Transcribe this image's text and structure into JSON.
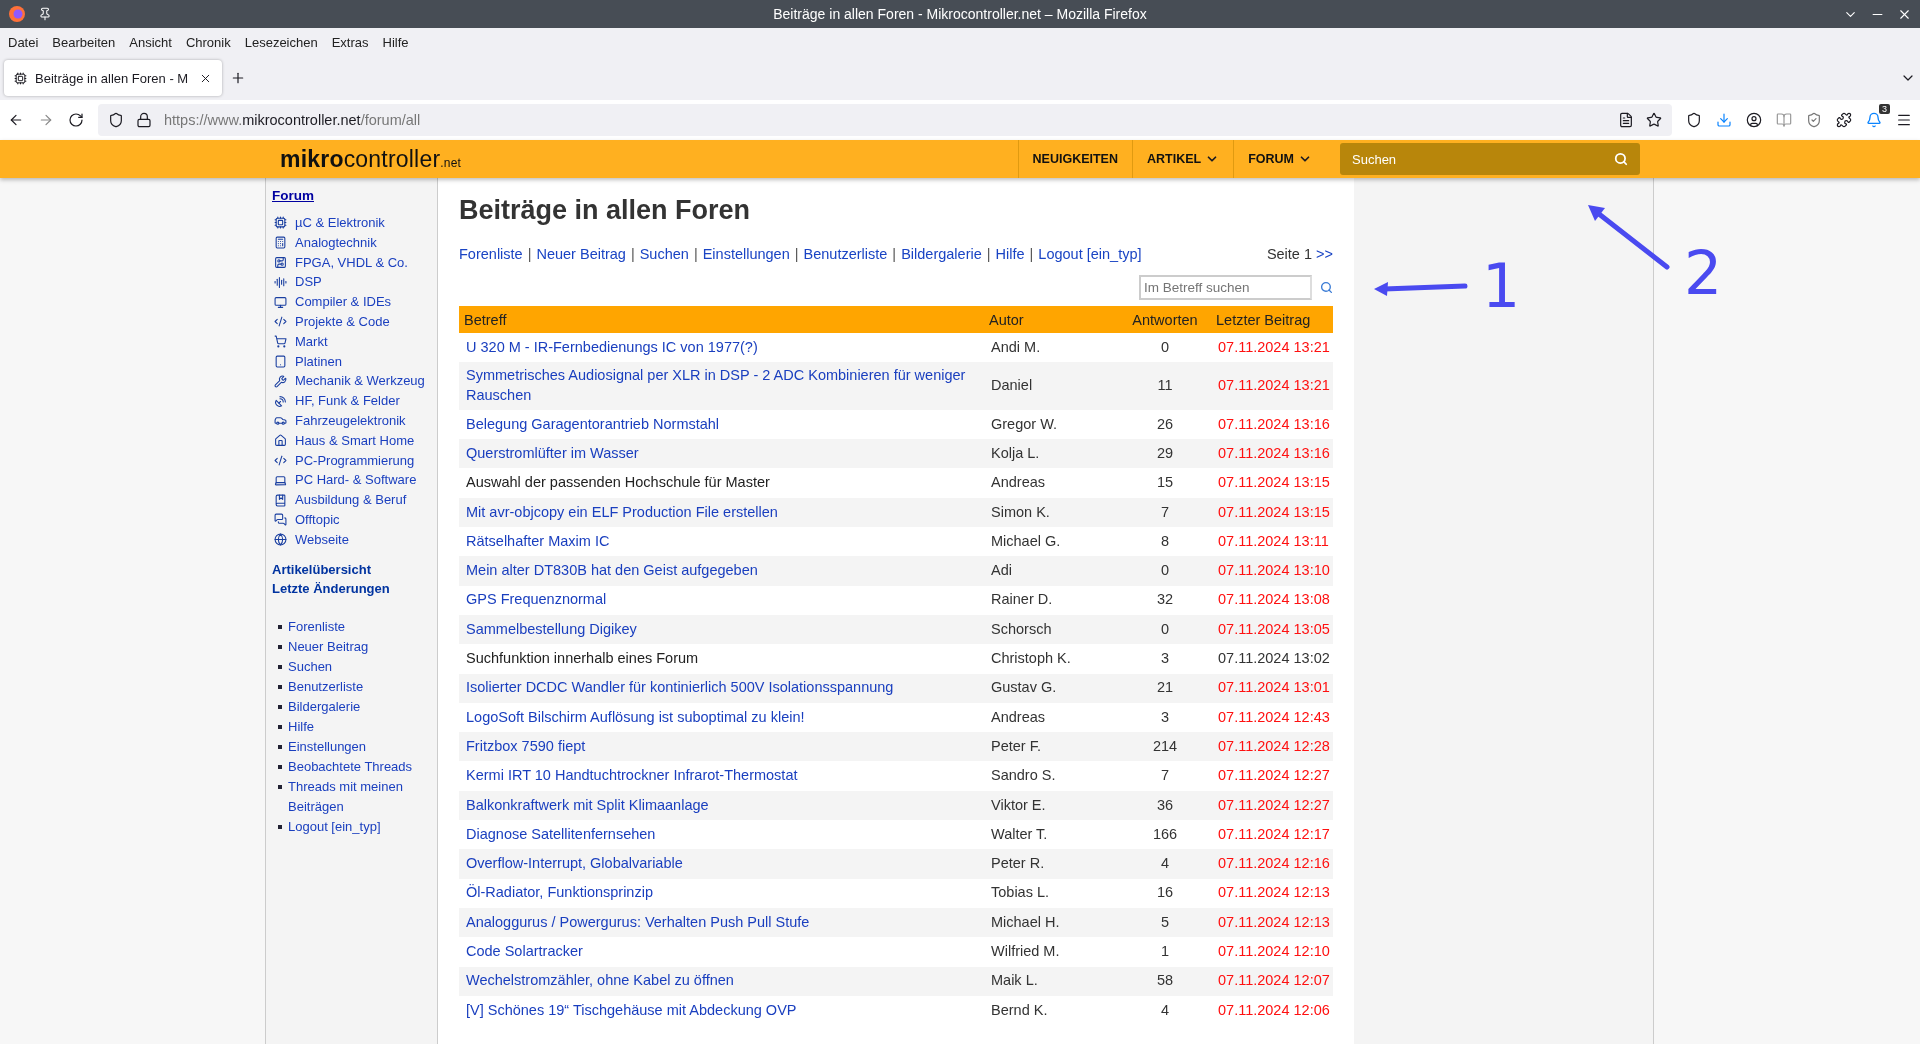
{
  "window": {
    "title": "Beiträge in allen Foren - Mikrocontroller.net – Mozilla Firefox"
  },
  "menu_bar": [
    "Datei",
    "Bearbeiten",
    "Ansicht",
    "Chronik",
    "Lesezeichen",
    "Extras",
    "Hilfe"
  ],
  "tabs": [
    {
      "label": "Beiträge in allen Foren - M",
      "selected": true
    }
  ],
  "address_bar": {
    "prefix": "https://www.",
    "domain": "mikrocontroller.net",
    "path": "/forum/all"
  },
  "toolbar": {
    "notification_badge": "3"
  },
  "site_header": {
    "logo_bold": "mikro",
    "logo_light": "controller",
    "logo_suffix": ".net",
    "nav": [
      {
        "label": "NEUIGKEITEN",
        "dropdown": false
      },
      {
        "label": "ARTIKEL",
        "dropdown": true
      },
      {
        "label": "FORUM",
        "dropdown": true
      }
    ],
    "search": {
      "placeholder": "Suchen"
    }
  },
  "sidebar": {
    "heading": "Forum",
    "forums": [
      "µC & Elektronik",
      "Analogtechnik",
      "FPGA, VHDL & Co.",
      "DSP",
      "Compiler & IDEs",
      "Projekte & Code",
      "Markt",
      "Platinen",
      "Mechanik & Werkzeug",
      "HF, Funk & Felder",
      "Fahrzeugelektronik",
      "Haus & Smart Home",
      "PC-Programmierung",
      "PC Hard- & Software",
      "Ausbildung & Beruf",
      "Offtopic",
      "Webseite"
    ],
    "bold_links": [
      "Artikelübersicht",
      "Letzte Änderungen"
    ],
    "links": [
      "Forenliste",
      "Neuer Beitrag",
      "Suchen",
      "Benutzerliste",
      "Bildergalerie",
      "Hilfe",
      "Einstellungen",
      "Beobachtete Threads",
      "Threads mit meinen Beiträgen",
      "Logout [ein_typ]"
    ]
  },
  "main": {
    "title": "Beiträge in allen Foren",
    "separator": "|",
    "links": [
      "Forenliste",
      "Neuer Beitrag",
      "Suchen",
      "Einstellungen",
      "Benutzerliste",
      "Bildergalerie",
      "Hilfe",
      "Logout [ein_typ]"
    ],
    "page_label": "Seite 1",
    "next_link": ">>",
    "subject_search": {
      "placeholder": "Im Betreff suchen"
    }
  },
  "table": {
    "columns": [
      "Betreff",
      "Autor",
      "Antworten",
      "Letzter Beitrag"
    ],
    "rows": [
      {
        "subject": "U 320 M - IR-Fernbedienungs IC von 1977(?)",
        "author": "Andi M.",
        "replies": "0",
        "last": "07.11.2024 13:21",
        "visited": false,
        "new": true
      },
      {
        "subject": "Symmetrisches Audiosignal per XLR in DSP - 2 ADC Kombinieren für weniger Rauschen",
        "author": "Daniel",
        "replies": "11",
        "last": "07.11.2024 13:21",
        "visited": false,
        "new": true
      },
      {
        "subject": "Belegung Garagentorantrieb Normstahl",
        "author": "Gregor W.",
        "replies": "26",
        "last": "07.11.2024 13:16",
        "visited": false,
        "new": true
      },
      {
        "subject": "Querstromlüfter im Wasser",
        "author": "Kolja L.",
        "replies": "29",
        "last": "07.11.2024 13:16",
        "visited": false,
        "new": true
      },
      {
        "subject": "Auswahl der passenden Hochschule für Master",
        "author": "Andreas",
        "replies": "15",
        "last": "07.11.2024 13:15",
        "visited": true,
        "new": true
      },
      {
        "subject": "Mit avr-objcopy ein ELF Production File erstellen",
        "author": "Simon K.",
        "replies": "7",
        "last": "07.11.2024 13:15",
        "visited": false,
        "new": true
      },
      {
        "subject": "Rätselhafter Maxim IC",
        "author": "Michael G.",
        "replies": "8",
        "last": "07.11.2024 13:11",
        "visited": false,
        "new": true
      },
      {
        "subject": "Mein alter DT830B hat den Geist aufgegeben",
        "author": "Adi",
        "replies": "0",
        "last": "07.11.2024 13:10",
        "visited": false,
        "new": true
      },
      {
        "subject": "GPS Frequenznormal",
        "author": "Rainer D.",
        "replies": "32",
        "last": "07.11.2024 13:08",
        "visited": false,
        "new": true
      },
      {
        "subject": "Sammelbestellung Digikey",
        "author": "Schorsch",
        "replies": "0",
        "last": "07.11.2024 13:05",
        "visited": false,
        "new": true
      },
      {
        "subject": "Suchfunktion innerhalb eines Forum",
        "author": "Christoph K.",
        "replies": "3",
        "last": "07.11.2024 13:02",
        "visited": true,
        "new": false
      },
      {
        "subject": "Isolierter DCDC Wandler für kontinierlich 500V Isolationsspannung",
        "author": "Gustav G.",
        "replies": "21",
        "last": "07.11.2024 13:01",
        "visited": false,
        "new": true
      },
      {
        "subject": "LogoSoft Bilschirm Auflösung ist suboptimal zu klein!",
        "author": "Andreas",
        "replies": "3",
        "last": "07.11.2024 12:43",
        "visited": false,
        "new": true
      },
      {
        "subject": "Fritzbox 7590 fiept",
        "author": "Peter F.",
        "replies": "214",
        "last": "07.11.2024 12:28",
        "visited": false,
        "new": true
      },
      {
        "subject": "Kermi IRT 10 Handtuchtrockner Infrarot-Thermostat",
        "author": "Sandro S.",
        "replies": "7",
        "last": "07.11.2024 12:27",
        "visited": false,
        "new": true
      },
      {
        "subject": "Balkonkraftwerk mit Split Klimaanlage",
        "author": "Viktor E.",
        "replies": "36",
        "last": "07.11.2024 12:27",
        "visited": false,
        "new": true
      },
      {
        "subject": "Diagnose Satellitenfernsehen",
        "author": "Walter T.",
        "replies": "166",
        "last": "07.11.2024 12:17",
        "visited": false,
        "new": true
      },
      {
        "subject": "Overflow-Interrupt, Globalvariable",
        "author": "Peter R.",
        "replies": "4",
        "last": "07.11.2024 12:16",
        "visited": false,
        "new": true
      },
      {
        "subject": "Öl-Radiator, Funktionsprinzip",
        "author": "Tobias L.",
        "replies": "16",
        "last": "07.11.2024 12:13",
        "visited": false,
        "new": true
      },
      {
        "subject": "Analoggurus / Powergurus: Verhalten Push Pull Stufe",
        "author": "Michael H.",
        "replies": "5",
        "last": "07.11.2024 12:13",
        "visited": false,
        "new": true
      },
      {
        "subject": "Code Solartracker",
        "author": "Wilfried M.",
        "replies": "1",
        "last": "07.11.2024 12:10",
        "visited": false,
        "new": true
      },
      {
        "subject": "Wechelstromzähler, ohne Kabel zu öffnen",
        "author": "Maik L.",
        "replies": "58",
        "last": "07.11.2024 12:07",
        "visited": false,
        "new": true
      },
      {
        "subject": "[V] Schönes 19“ Tischgehäuse mit Abdeckung OVP",
        "author": "Bernd K.",
        "replies": "4",
        "last": "07.11.2024 12:06",
        "visited": false,
        "new": true
      }
    ]
  },
  "annotations": [
    "1",
    "2"
  ]
}
